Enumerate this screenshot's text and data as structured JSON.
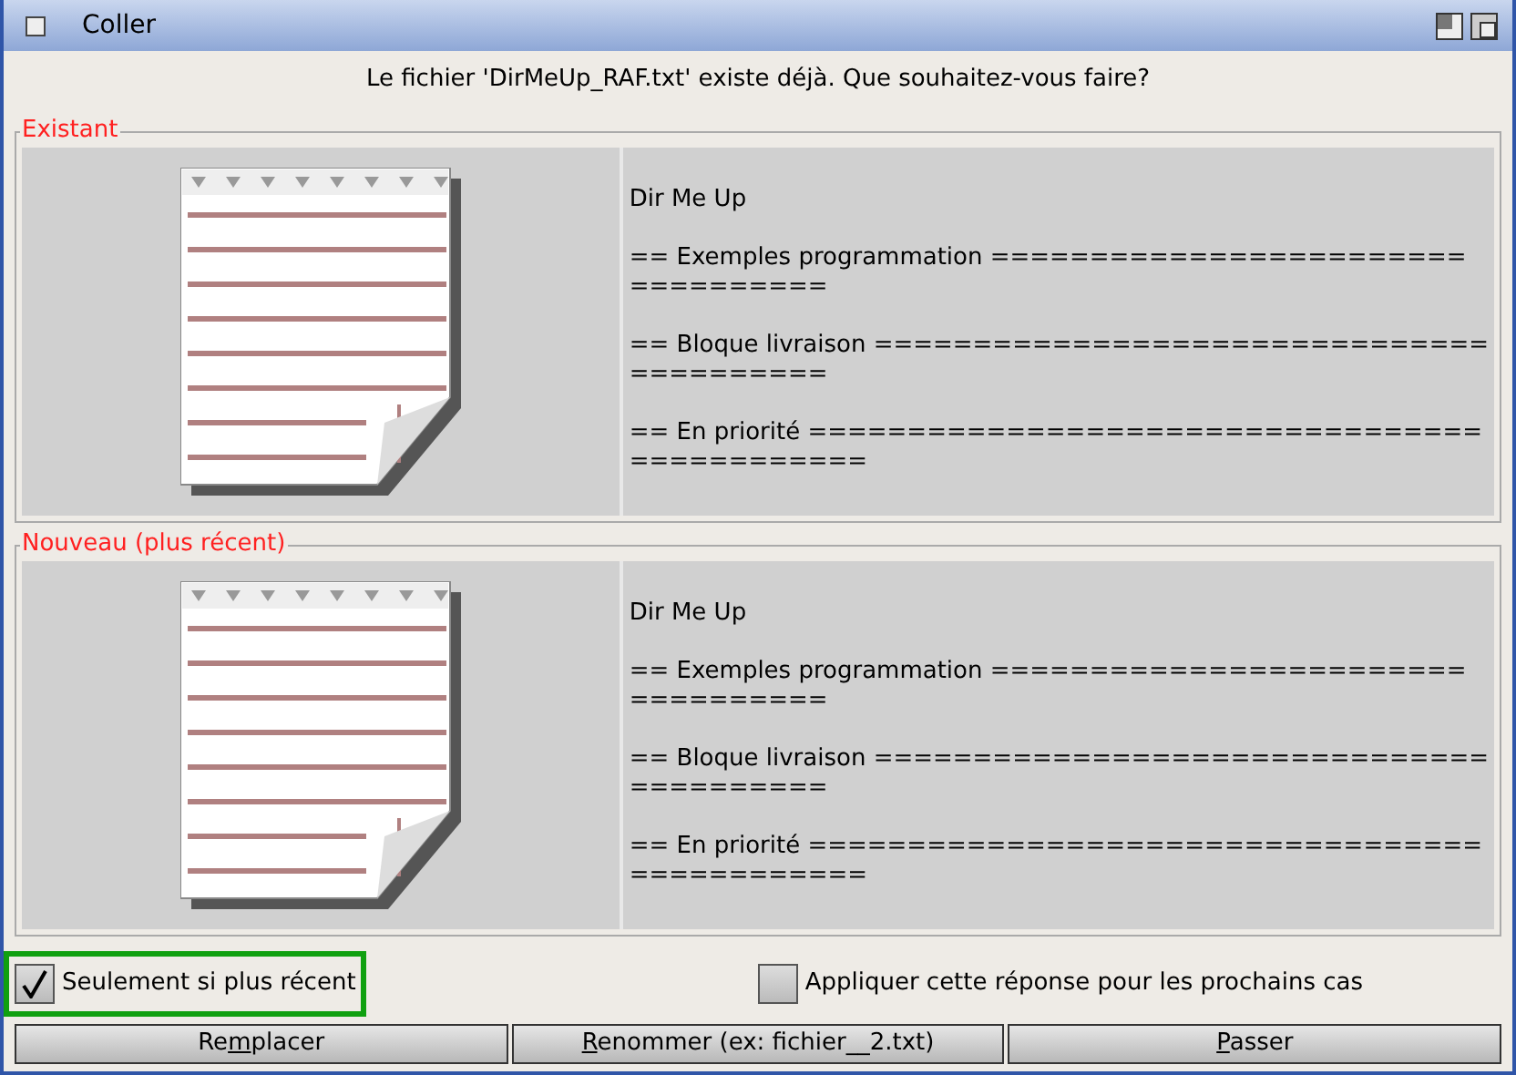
{
  "window": {
    "title": "Coller"
  },
  "message": "Le fichier 'DirMeUp_RAF.txt' existe déjà.  Que souhaitez-vous faire?",
  "groups": [
    {
      "legend": "Existant",
      "paragraphs": [
        [
          "Dir Me Up"
        ],
        [
          "== Exemples programmation ========================",
          "=========="
        ],
        [
          "== Bloque livraison ===============================",
          "=========="
        ],
        [
          "== En priorité ==================================",
          "============"
        ]
      ]
    },
    {
      "legend": "Nouveau (plus récent)",
      "paragraphs": [
        [
          "Dir Me Up"
        ],
        [
          "== Exemples programmation ========================",
          "=========="
        ],
        [
          "== Bloque livraison ===============================",
          "=========="
        ],
        [
          "== En priorité ==================================",
          "============"
        ]
      ]
    }
  ],
  "options": [
    {
      "label": "Seulement si plus récent",
      "checked": true,
      "focused": true
    },
    {
      "label": "Appliquer cette réponse pour les prochains cas",
      "checked": false,
      "focused": false
    }
  ],
  "buttons": [
    {
      "before": "Re",
      "key": "m",
      "after": "placer"
    },
    {
      "key": "R",
      "after": "enommer (ex: fichier__2.txt)"
    },
    {
      "key": "P",
      "after": "asser"
    }
  ]
}
